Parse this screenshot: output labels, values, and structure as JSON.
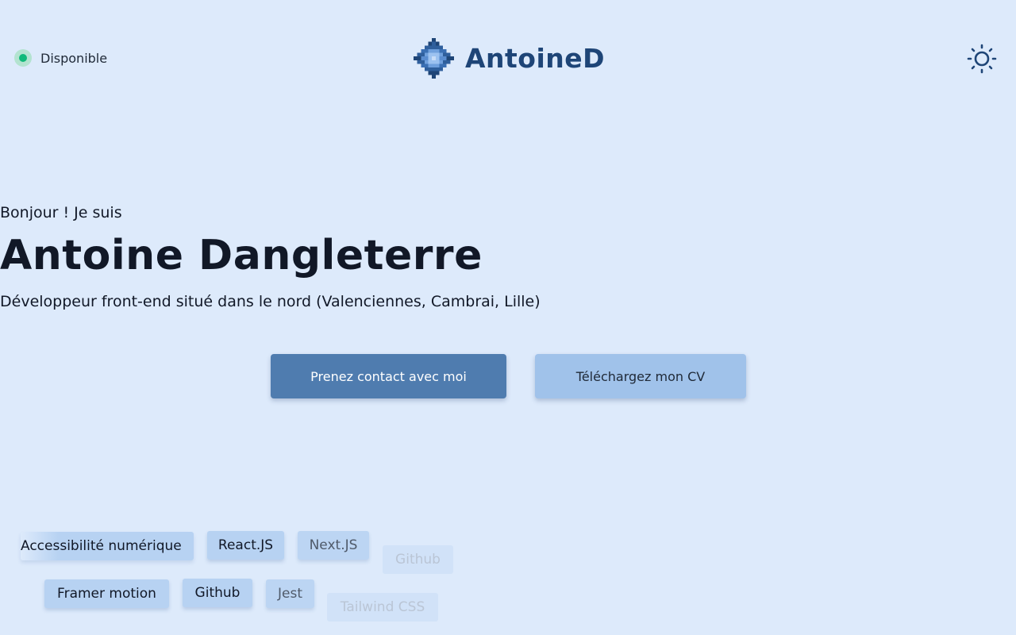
{
  "header": {
    "status_label": "Disponible",
    "brand_name": "AntoineD",
    "colors": {
      "status_dot": "#10b97a",
      "brand": "#1e4577"
    }
  },
  "hero": {
    "greeting": "Bonjour ! Je suis",
    "name": "Antoine Dangleterre",
    "subtitle": "Développeur front-end situé dans le nord (Valenciennes, Cambrai, Lille)",
    "contact_button": "Prenez contact avec moi",
    "cv_button": "Téléchargez mon CV"
  },
  "skills": {
    "row1": [
      "Accessibilité numérique",
      "React.JS",
      "Next.JS",
      "Github"
    ],
    "row2": [
      "Framer motion",
      "Github",
      "Jest",
      "Tailwind CSS"
    ]
  },
  "icons": {
    "theme_toggle": "sun-icon",
    "logo": "pixel-diamond-logo"
  },
  "colors": {
    "background": "#ddeafb",
    "primary_button": "#4f7caf",
    "secondary_button": "#a0c2ea",
    "tag": "#b7d2f2"
  }
}
